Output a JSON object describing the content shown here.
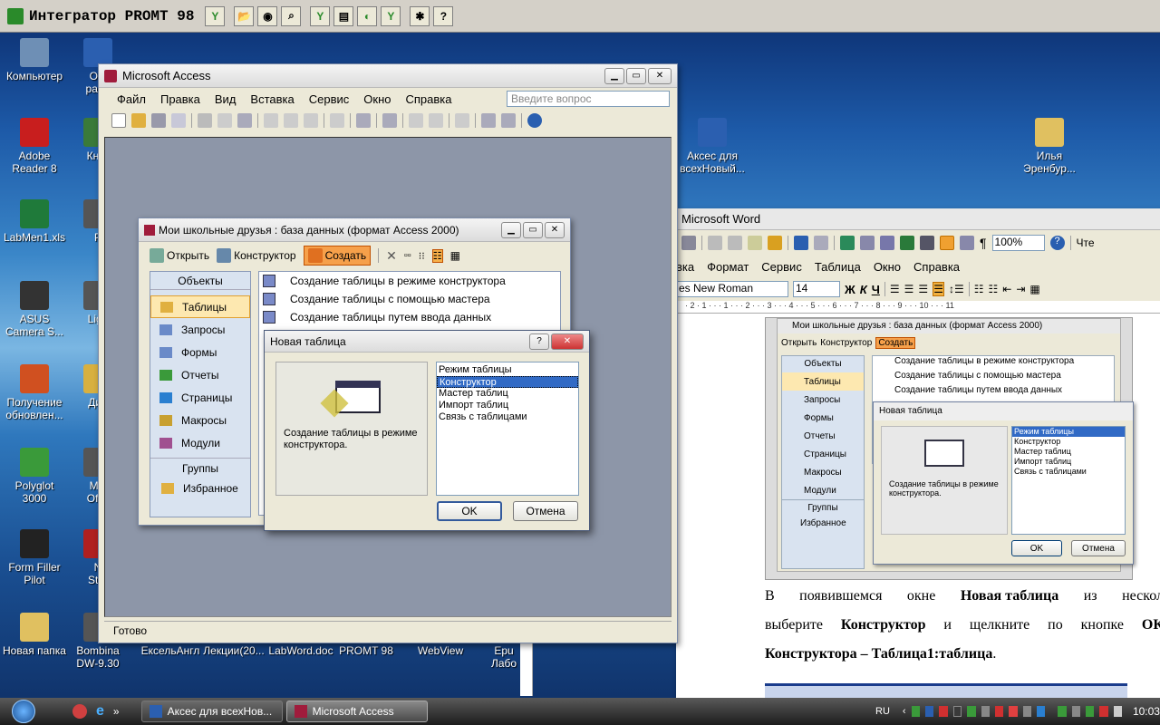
{
  "promt": {
    "title": "Интегратор PROMT 98",
    "buttons": [
      "folder-open",
      "globe",
      "search",
      "promt-y",
      "doc",
      "gear-circle",
      "promt-y2",
      "settings",
      "help"
    ],
    "help_label": "?"
  },
  "desktop": {
    "icons": [
      {
        "name": "computer",
        "label": "Компьютер",
        "color": "#6e8fb5"
      },
      {
        "name": "word-doc-1",
        "label": "О с\nрабо",
        "color": "#2b5fb0"
      },
      {
        "name": "adobe",
        "label": "Adobe\nReader 8",
        "color": "#c81e1e"
      },
      {
        "name": "book",
        "label": "Книг",
        "color": "#3a7a3a"
      },
      {
        "name": "labmen",
        "label": "LabMen1.xls",
        "color": "#1f7a3a"
      },
      {
        "name": "p",
        "label": "P",
        "color": "#555"
      },
      {
        "name": "asus",
        "label": "ASUS\nCamera S...",
        "color": "#333"
      },
      {
        "name": "light",
        "label": "Ligh",
        "color": "#555"
      },
      {
        "name": "updates",
        "label": "Получение\nобновлен...",
        "color": "#d05020"
      },
      {
        "name": "dia",
        "label": "Диа",
        "color": "#d8b040"
      },
      {
        "name": "polyglot",
        "label": "Polyglot 3000",
        "color": "#3a9a3a"
      },
      {
        "name": "office",
        "label": "Mic\nOffic",
        "color": "#555"
      },
      {
        "name": "formfiller",
        "label": "Form Filler\nPilot",
        "color": "#222"
      },
      {
        "name": "start",
        "label": "N\nStar",
        "color": "#b02020"
      },
      {
        "name": "newfolder",
        "label": "Новая папка",
        "color": "#e0c060"
      },
      {
        "name": "bombina",
        "label": "Bombina\nDW-9.30",
        "color": "#555"
      },
      {
        "name": "excelangl",
        "label": "ЕксельАнгл",
        "color": "#1f7a3a"
      },
      {
        "name": "lectures",
        "label": "Лекции(20...",
        "color": "#d8b040"
      },
      {
        "name": "labword",
        "label": "LabWord.doc",
        "color": "#2b5fb0"
      },
      {
        "name": "promt98",
        "label": "PROMT 98",
        "color": "#b02020"
      },
      {
        "name": "webview",
        "label": "WebView",
        "color": "#555"
      },
      {
        "name": "epu",
        "label": "Еpu\nЛабо",
        "color": "#2b5fb0"
      },
      {
        "name": "acces-doc",
        "label": "Аксес для\nвсехНовый...",
        "color": "#2b5fb0"
      },
      {
        "name": "ilya",
        "label": "Илья\nЭренбур...",
        "color": "#e0c060"
      }
    ]
  },
  "access": {
    "title": "Microsoft Access",
    "menu": [
      "Файл",
      "Правка",
      "Вид",
      "Вставка",
      "Сервис",
      "Окно",
      "Справка"
    ],
    "question_placeholder": "Введите вопрос",
    "status": "Готово"
  },
  "db": {
    "title": "Мои школьные друзья : база данных (формат Access 2000)",
    "toolbar": {
      "open": "Открыть",
      "design": "Конструктор",
      "create": "Создать"
    },
    "objects_header": "Объекты",
    "nav": [
      "Таблицы",
      "Запросы",
      "Формы",
      "Отчеты",
      "Страницы",
      "Макросы",
      "Модули"
    ],
    "groups_header": "Группы",
    "favorites": "Избранное",
    "items": [
      "Создание таблицы в режиме конструктора",
      "Создание таблицы с помощью мастера",
      "Создание таблицы путем ввода данных"
    ]
  },
  "dialog": {
    "title": "Новая таблица",
    "help": "?",
    "description": "Создание таблицы в режиме конструктора.",
    "options": [
      "Режим таблицы",
      "Конструктор",
      "Мастер таблиц",
      "Импорт таблиц",
      "Связь с таблицами"
    ],
    "selected": 1,
    "ok": "OK",
    "cancel": "Отмена"
  },
  "word": {
    "title": "Microsoft Word",
    "menu": [
      "вка",
      "Формат",
      "Сервис",
      "Таблица",
      "Окно",
      "Справка"
    ],
    "font": "es New Roman",
    "size": "14",
    "zoom": "100%",
    "read": "Чте",
    "ruler": "· 2 · 1 · · · 1 · · · 2 · · · 3 · · · 4 · · · 5 · · · 6 · · · 7 · · · 8 · · · 9 · · · 10 · · · 11",
    "line1": [
      "В",
      "появившемся",
      "окне",
      "Новая таблица",
      "из",
      "нескол"
    ],
    "line2": [
      "выберите",
      "Конструктор",
      "и",
      "щелкните",
      "по",
      "кнопке",
      "ОК"
    ],
    "line3": [
      "Конструктора – Таблица1:таблица",
      "."
    ],
    "ruler_v": "15 · 14 ·",
    "shot": {
      "title": "Мои школьные друзья : база данных (формат Access 2000)",
      "open": "Открыть",
      "design": "Конструктор",
      "create": "Создать",
      "objects": "Объекты",
      "nav": [
        "Таблицы",
        "Запросы",
        "Формы",
        "Отчеты",
        "Страницы",
        "Макросы",
        "Модули"
      ],
      "groups": "Группы",
      "favorites": "Избранное",
      "items": [
        "Создание таблицы в режиме конструктора",
        "Создание таблицы с помощью мастера",
        "Создание таблицы путем ввода данных"
      ],
      "dlg_title": "Новая таблица",
      "dlg_desc": "Создание таблицы в режиме конструктора.",
      "options": [
        "Режим таблицы",
        "Конструктор",
        "Мастер таблиц",
        "Импорт таблиц",
        "Связь с таблицами"
      ],
      "ok": "OK",
      "cancel": "Отмена"
    }
  },
  "taskbar": {
    "tasks": [
      "Аксес для всехНов...",
      "Microsoft Access"
    ],
    "lang": "RU",
    "time": "10:03",
    "chevron": "»"
  }
}
